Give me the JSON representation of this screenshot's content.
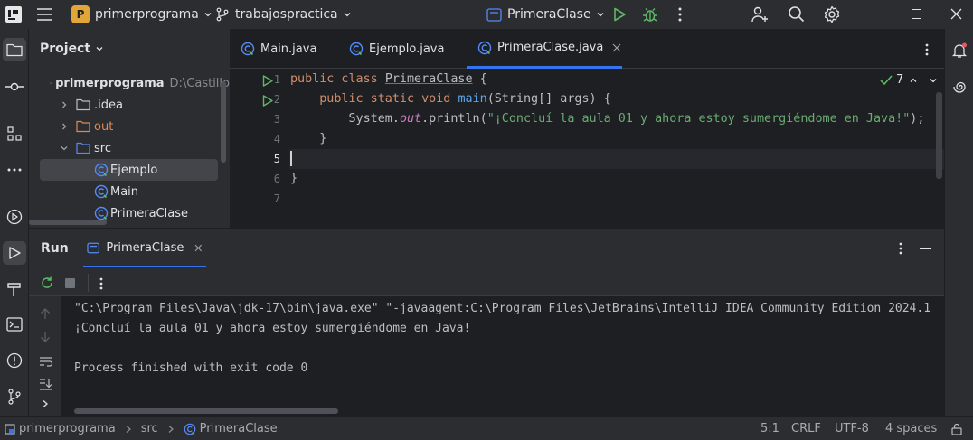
{
  "titlebar": {
    "project_badge": "P",
    "project_name": "primerprograma",
    "vcs_branch": "trabajospractica",
    "run_config": "PrimeraClase"
  },
  "project_panel": {
    "title": "Project",
    "tree": [
      {
        "label": "primerprograma",
        "path": "D:\\Castillo"
      },
      {
        "label": ".idea"
      },
      {
        "label": "out"
      },
      {
        "label": "src"
      },
      {
        "label": "Ejemplo"
      },
      {
        "label": "Main"
      },
      {
        "label": "PrimeraClase"
      }
    ]
  },
  "editor": {
    "tabs": [
      {
        "label": "Main.java"
      },
      {
        "label": "Ejemplo.java"
      },
      {
        "label": "PrimeraClase.java"
      }
    ],
    "inspection_count": "7",
    "line_numbers": [
      "1",
      "2",
      "3",
      "4",
      "5",
      "6",
      "7"
    ],
    "code": {
      "l1_kw": "public class ",
      "l1_name": "PrimeraClase",
      "l1_rest": " {",
      "l2_indent": "    ",
      "l2_kw": "public static void ",
      "l2_fn": "main",
      "l2_rest": "(String[] args) {",
      "l3_indent": "        ",
      "l3_a": "System.",
      "l3_out": "out",
      "l3_b": ".println(",
      "l3_str": "\"¡Concluí la aula 01 y ahora estoy sumergiéndome en Java!\"",
      "l3_c": ");",
      "l4": "    }",
      "l6": "}"
    }
  },
  "run_panel": {
    "title": "Run",
    "tab_label": "PrimeraClase",
    "output": [
      "\"C:\\Program Files\\Java\\jdk-17\\bin\\java.exe\" \"-javaagent:C:\\Program Files\\JetBrains\\IntelliJ IDEA Community Edition 2024.1",
      "¡Concluí la aula 01 y ahora estoy sumergiéndome en Java!",
      "",
      "Process finished with exit code 0"
    ]
  },
  "statusbar": {
    "breadcrumb": [
      "primerprograma",
      "src",
      "PrimeraClase"
    ],
    "position": "5:1",
    "line_sep": "CRLF",
    "encoding": "UTF-8",
    "indent": "4 spaces"
  },
  "colors": {
    "accent": "#3574f0",
    "run_green": "#5fb865",
    "project_badge": "#e0a63a"
  }
}
